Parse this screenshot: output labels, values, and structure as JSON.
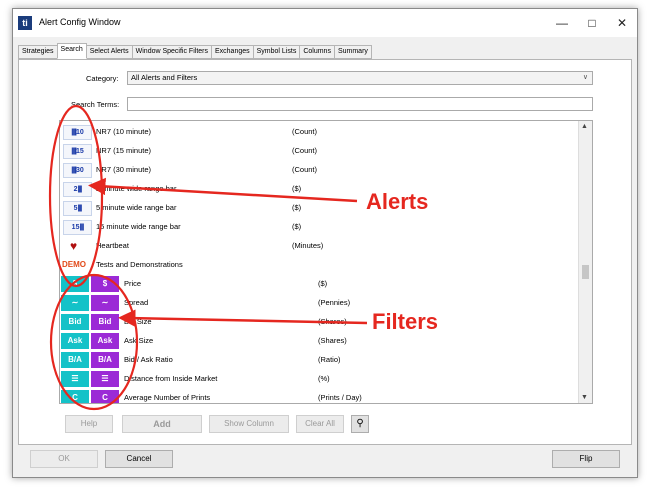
{
  "window": {
    "title": "Alert Config Window",
    "icon_text": "ti"
  },
  "tabs": [
    "Strategies",
    "Search",
    "Select Alerts",
    "Window Specific Filters",
    "Exchanges",
    "Symbol Lists",
    "Columns",
    "Summary"
  ],
  "search_panel": {
    "category_label": "Category:",
    "category_value": "All Alerts and Filters",
    "search_label": "Search Terms:",
    "search_value": ""
  },
  "alerts": [
    {
      "icon": "10",
      "name": "NR7 (10 minute)",
      "unit": "(Count)"
    },
    {
      "icon": "15",
      "name": "NR7 (15 minute)",
      "unit": "(Count)"
    },
    {
      "icon": "30",
      "name": "NR7 (30 minute)",
      "unit": "(Count)"
    },
    {
      "icon": "2",
      "name": "2 minute wide range bar",
      "unit": "($)"
    },
    {
      "icon": "5",
      "name": "5 minute wide range bar",
      "unit": "($)"
    },
    {
      "icon": "15",
      "name": "15 minute wide range bar",
      "unit": "($)"
    },
    {
      "icon": "heart",
      "name": "Heartbeat",
      "unit": "(Minutes)"
    }
  ],
  "section": {
    "icon_text": "DEMO",
    "name": "Tests and Demonstrations"
  },
  "filters": [
    {
      "icon": "$",
      "name": "Price",
      "unit": "($)"
    },
    {
      "icon": "spread",
      "name": "Spread",
      "unit": "(Pennies)"
    },
    {
      "icon": "Bid",
      "name": "Bid Size",
      "unit": "(Shares)"
    },
    {
      "icon": "Ask",
      "name": "Ask Size",
      "unit": "(Shares)"
    },
    {
      "icon": "B/A",
      "name": "Bid / Ask Ratio",
      "unit": "(Ratio)"
    },
    {
      "icon": "lines",
      "name": "Distance from Inside Market",
      "unit": "(%)"
    },
    {
      "icon": "C",
      "name": "Average Number of Prints",
      "unit": "(Prints / Day)"
    }
  ],
  "buttons": {
    "help": "Help",
    "add": "Add",
    "show_column": "Show Column",
    "clear_all": "Clear All",
    "ok": "OK",
    "cancel": "Cancel",
    "flip": "Flip"
  },
  "annotations": {
    "alerts_label": "Alerts",
    "filters_label": "Filters",
    "color": "#e5271f"
  },
  "colors": {
    "filter_cyan": "#14c2c8",
    "filter_purple": "#9b2ad6",
    "alert_blue": "#1a3aa8"
  }
}
